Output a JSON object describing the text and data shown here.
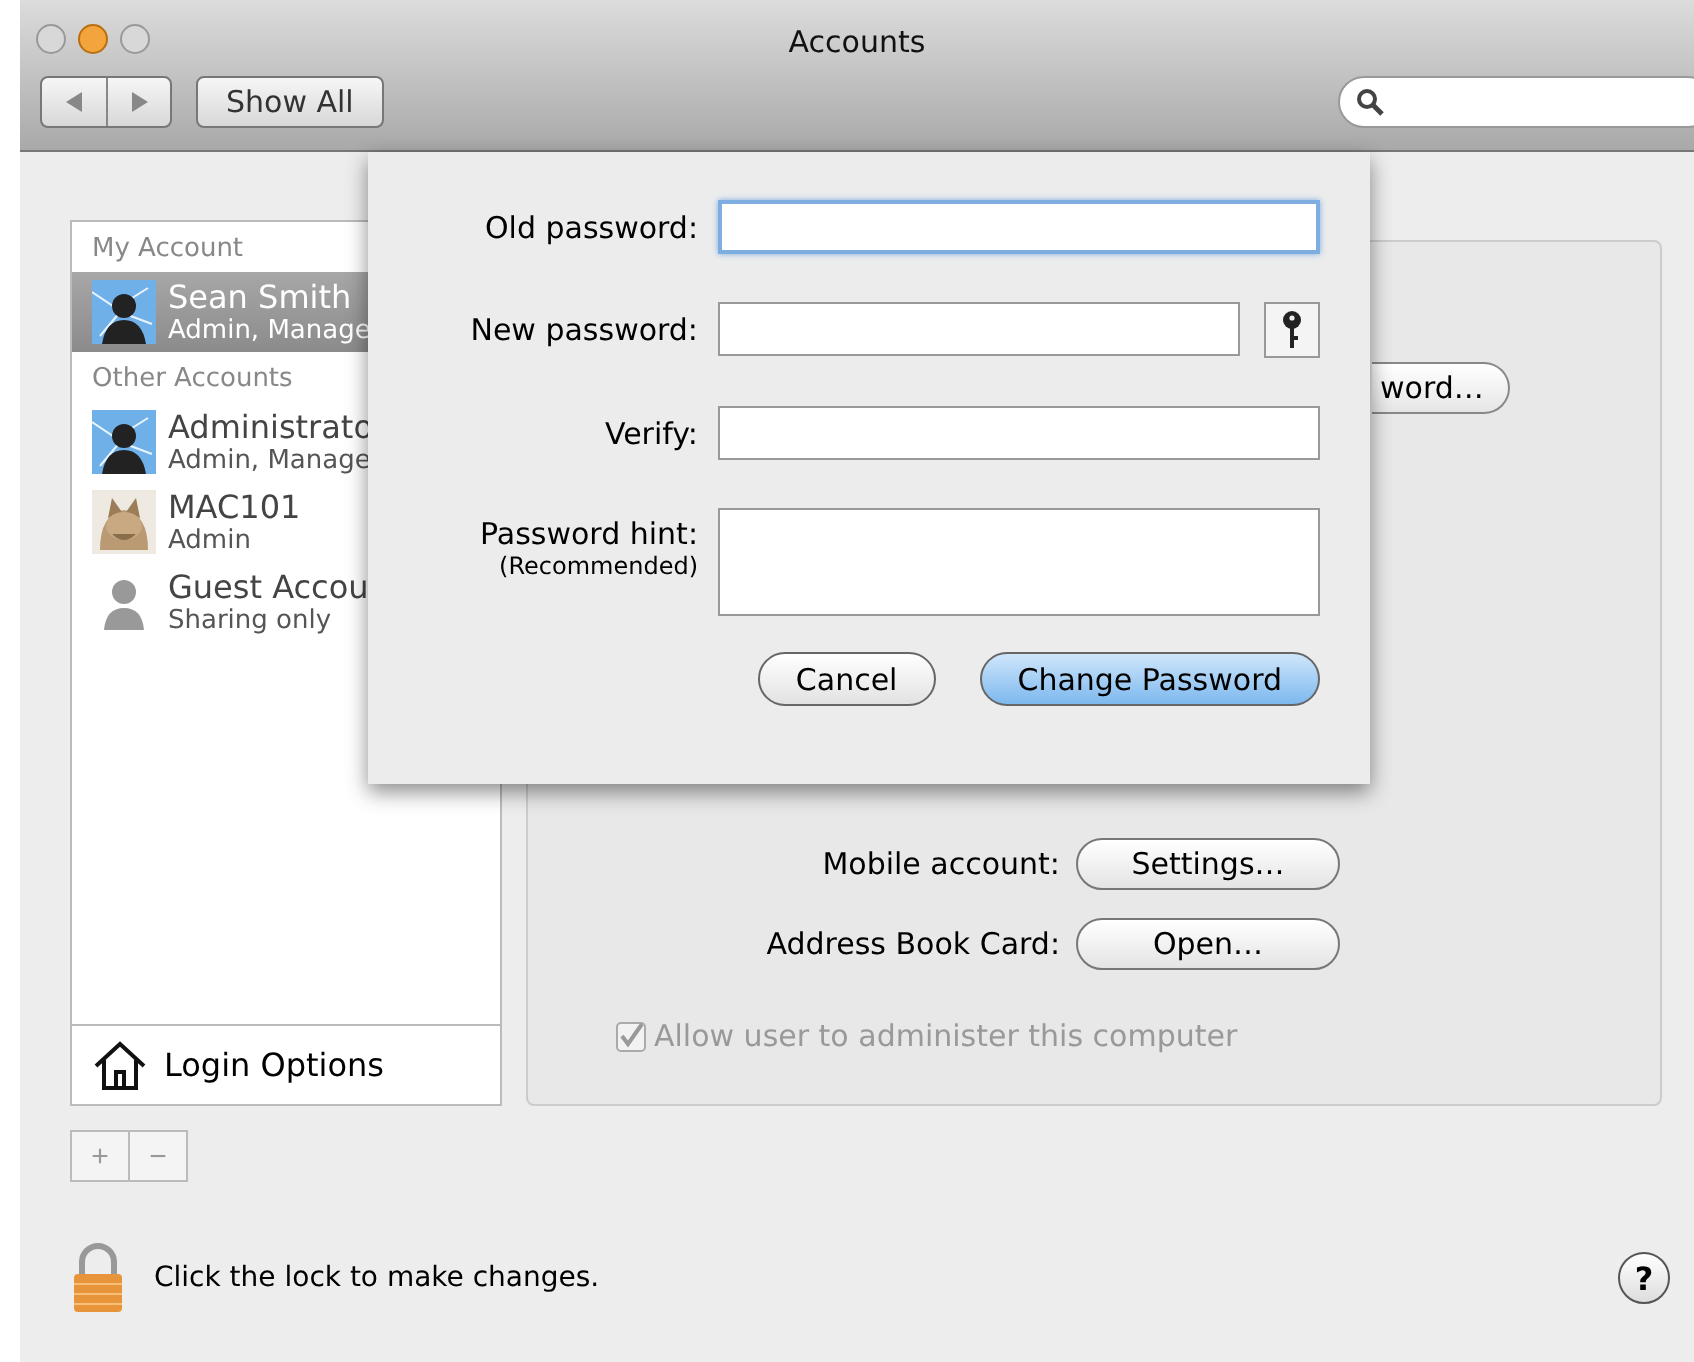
{
  "window": {
    "title": "Accounts"
  },
  "toolbar": {
    "show_all": "Show All"
  },
  "sidebar": {
    "items": [
      {
        "kind": "header",
        "label": "My Account"
      },
      {
        "kind": "account",
        "name": "Sean Smith",
        "role": "Admin, Manage",
        "avatar": {
          "kind": "network"
        },
        "selected": true
      },
      {
        "kind": "header",
        "label": "Other Accounts"
      },
      {
        "kind": "account",
        "name": "Administrato",
        "role": "Admin, Manage",
        "avatar": {
          "kind": "network"
        },
        "selected": false
      },
      {
        "kind": "account",
        "name": "MAC101",
        "role": "Admin",
        "selected": false
      },
      {
        "kind": "account",
        "name": "Guest Accou",
        "role": "Sharing only",
        "avatar": {
          "kind": "guest"
        },
        "selected": false
      }
    ],
    "login_options": "Login Options"
  },
  "panel": {
    "partial_button": "word…",
    "rows": [
      {
        "label": "Mobile account:",
        "button": "Settings…"
      },
      {
        "label": "Address Book Card:",
        "button": "Open…"
      }
    ],
    "admin_checkbox": {
      "label": "Allow user to administer this computer",
      "checked": true,
      "disabled": true
    }
  },
  "add_remove": {
    "add": "+",
    "remove": "−"
  },
  "lock": {
    "text": "Click the lock to make changes."
  },
  "help": "?",
  "sheet": {
    "fields": [
      {
        "label": "Old password:",
        "kind": "focused"
      },
      {
        "label": "New password:",
        "kind": "with_key"
      },
      {
        "label": "Verify:",
        "kind": "plain"
      },
      {
        "label": "Password hint:",
        "sublabel": "(Recommended)",
        "kind": "multiline"
      }
    ],
    "cancel": "Cancel",
    "confirm": "Change Password"
  }
}
